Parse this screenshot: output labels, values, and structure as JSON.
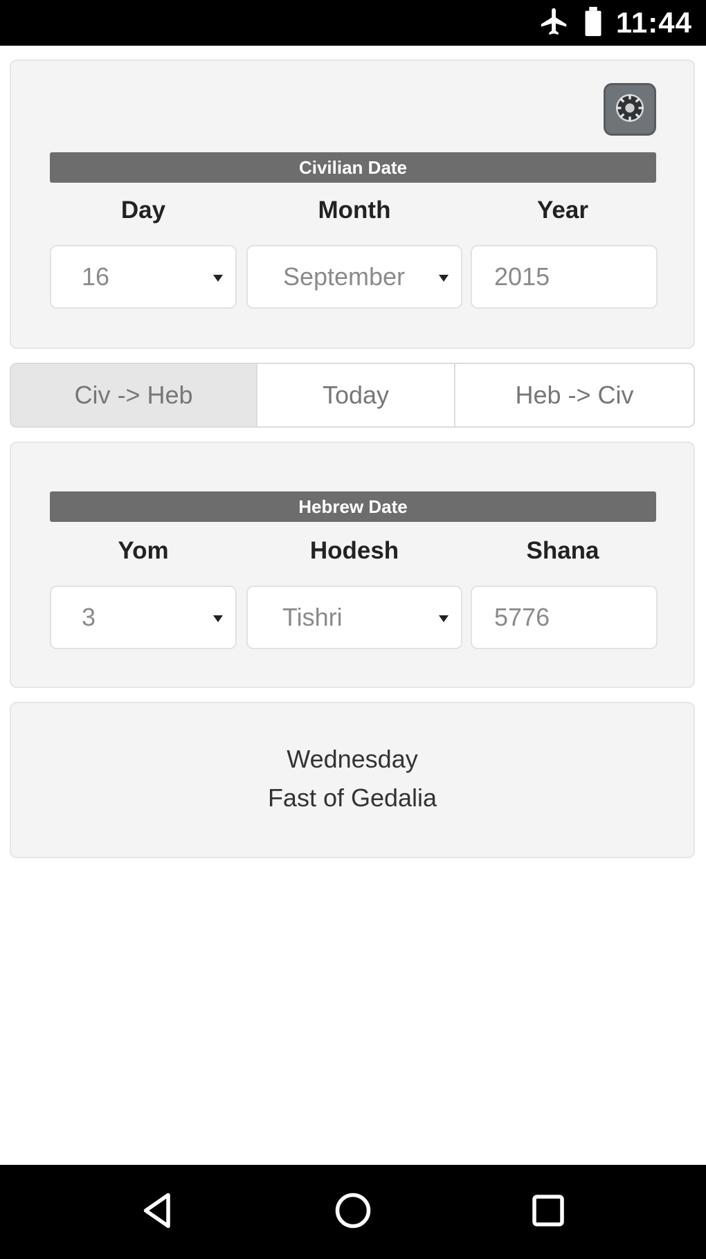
{
  "status_bar": {
    "time": "11:44",
    "icons": [
      "airplane-mode-icon",
      "battery-icon"
    ]
  },
  "civilian": {
    "header": "Civilian Date",
    "labels": {
      "day": "Day",
      "month": "Month",
      "year": "Year"
    },
    "values": {
      "day": "16",
      "month": "September",
      "year": "2015"
    }
  },
  "actions": {
    "civ_to_heb": "Civ -> Heb",
    "today": "Today",
    "heb_to_civ": "Heb -> Civ",
    "active": "civ_to_heb"
  },
  "hebrew": {
    "header": "Hebrew Date",
    "labels": {
      "yom": "Yom",
      "hodesh": "Hodesh",
      "shana": "Shana"
    },
    "values": {
      "yom": "3",
      "hodesh": "Tishri",
      "shana": "5776"
    }
  },
  "result": {
    "weekday": "Wednesday",
    "holiday": "Fast of Gedalia"
  },
  "nav_bar": {
    "icons": [
      "back-icon",
      "home-icon",
      "recents-icon"
    ]
  },
  "colors": {
    "section_bar": "#6d6d6d",
    "panel_bg": "#f4f4f4",
    "active_segment": "#e6e6e6"
  }
}
